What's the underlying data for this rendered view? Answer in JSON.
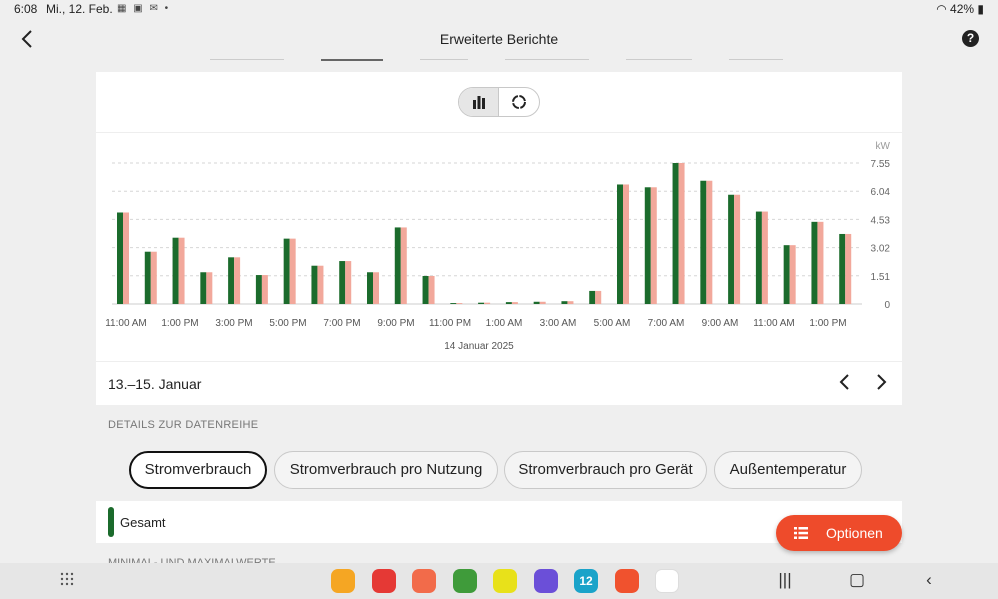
{
  "status": {
    "time": "6:08",
    "date": "Mi., 12. Feb.",
    "battery": "42%"
  },
  "header": {
    "title": "Erweiterte Berichte"
  },
  "chart": {
    "toggle_icons": [
      "bar-chart-icon",
      "ring-chart-icon"
    ],
    "range_label": "13.–15. Januar",
    "colors": {
      "primary": "#1b6b2c",
      "secondary": "#f2a89b",
      "primary_light": "#cfe9d3",
      "secondary_light": "#fbd9d1"
    }
  },
  "chart_data": {
    "type": "bar",
    "ylabel": "kW",
    "xlabel": "14 Januar 2025",
    "y_ticks": [
      "7.55",
      "6.04",
      "4.53",
      "3.02",
      "1.51",
      "0"
    ],
    "ylim": [
      0,
      7.55
    ],
    "x_tick_labels": [
      "11:00 AM",
      "1:00 PM",
      "3:00 PM",
      "5:00 PM",
      "7:00 PM",
      "9:00 PM",
      "11:00 PM",
      "1:00 AM",
      "3:00 AM",
      "5:00 AM",
      "7:00 AM",
      "9:00 AM",
      "11:00 AM",
      "1:00 PM"
    ],
    "series": [
      {
        "values": [
          4.9,
          2.8,
          3.55,
          1.7,
          2.5,
          1.55,
          3.5,
          2.05,
          2.3,
          1.7,
          4.1,
          1.5,
          0.05,
          0.07,
          0.1,
          0.12,
          0.15,
          0.7,
          6.4,
          6.25,
          7.55,
          6.6,
          5.85,
          4.95,
          3.15,
          4.4,
          3.75
        ]
      },
      {
        "values": [
          4.9,
          2.8,
          3.55,
          1.7,
          2.5,
          1.55,
          3.5,
          2.05,
          2.3,
          1.7,
          4.1,
          1.5,
          0.05,
          0.07,
          0.1,
          0.12,
          0.15,
          0.7,
          6.4,
          6.25,
          7.55,
          6.6,
          5.85,
          4.95,
          3.15,
          4.4,
          3.75
        ]
      }
    ],
    "grid": true
  },
  "details": {
    "section_label": "DETAILS ZUR DATENREIHE",
    "chips": [
      "Stromverbrauch",
      "Stromverbrauch pro Nutzung",
      "Stromverbrauch pro Gerät",
      "Außentemperatur"
    ],
    "selected_chip": "Stromverbrauch"
  },
  "legend": {
    "label": "Gesamt"
  },
  "next_section_label": "MINIMAL- UND MAXIMALWERTE",
  "fab": {
    "label": "Optionen"
  },
  "dock": {
    "apps": [
      {
        "icon": "folder-icon",
        "color": "#f5a623"
      },
      {
        "icon": "notes-icon",
        "color": "#e53935"
      },
      {
        "icon": "contacts-icon",
        "color": "#f26b4a"
      },
      {
        "icon": "calculator-icon",
        "color": "#3f9b3a"
      },
      {
        "icon": "tool-icon",
        "color": "#e8e11a"
      },
      {
        "icon": "internet-icon",
        "color": "#6b4fd8"
      },
      {
        "icon": "calendar-icon",
        "color": "#1aa3c9",
        "text": "12"
      },
      {
        "icon": "home-app-icon",
        "color": "#f0522e"
      },
      {
        "icon": "sheets-icon",
        "color": "#ffffff"
      }
    ]
  }
}
